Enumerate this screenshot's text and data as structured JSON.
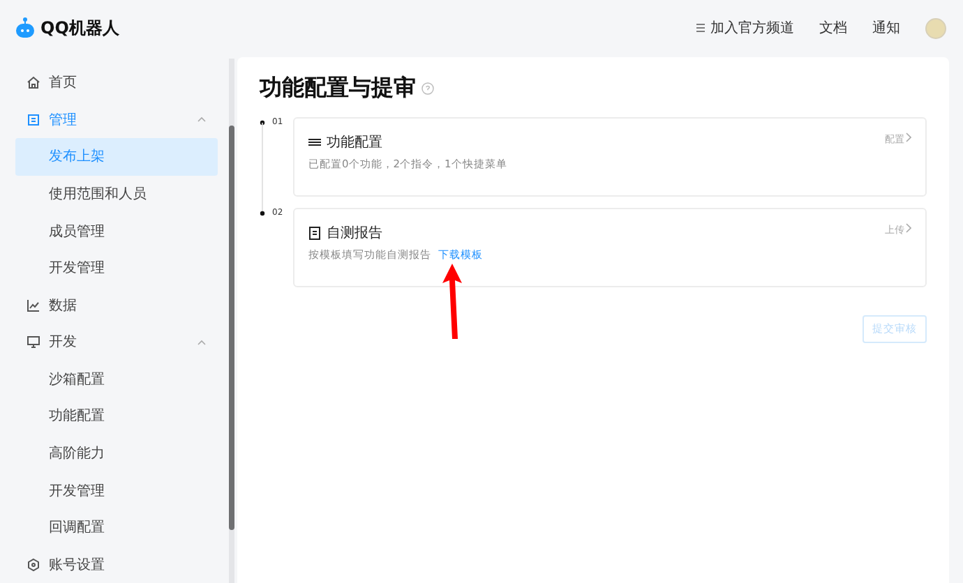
{
  "header": {
    "logo": "QQ机器人",
    "links": [
      "加入官方频道",
      "文档",
      "通知"
    ]
  },
  "sidebar": {
    "items": [
      {
        "label": "首页",
        "selected": false
      },
      {
        "label": "管理",
        "selected": true,
        "expanded": true,
        "children": [
          {
            "label": "发布上架",
            "selected": true
          },
          {
            "label": "使用范围和人员",
            "selected": false
          },
          {
            "label": "成员管理",
            "selected": false
          },
          {
            "label": "开发管理",
            "selected": false
          }
        ]
      },
      {
        "label": "数据",
        "selected": false
      },
      {
        "label": "开发",
        "selected": false,
        "expanded": true,
        "children": [
          {
            "label": "沙箱配置",
            "selected": false
          },
          {
            "label": "功能配置",
            "selected": false
          },
          {
            "label": "高阶能力",
            "selected": false
          },
          {
            "label": "开发管理",
            "selected": false
          },
          {
            "label": "回调配置",
            "selected": false
          }
        ]
      },
      {
        "label": "账号设置",
        "selected": false
      }
    ]
  },
  "page": {
    "title": "功能配置与提审",
    "steps": [
      {
        "number": "01",
        "title": "功能配置",
        "description": "已配置0个功能，2个指令，1个快捷菜单",
        "action": "配置"
      },
      {
        "number": "02",
        "title": "自测报告",
        "description": "按模板填写功能自测报告",
        "link": "下载模板",
        "action": "上传"
      }
    ],
    "submit": {
      "label": "提交审核",
      "disabled": true
    }
  }
}
